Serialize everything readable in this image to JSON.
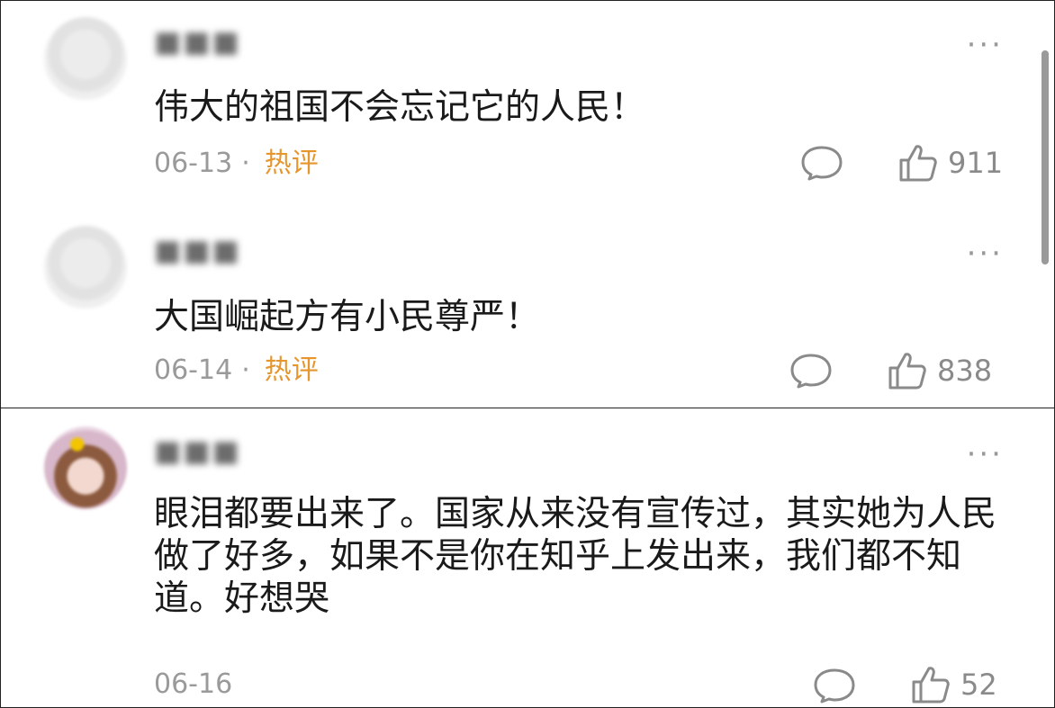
{
  "comments": [
    {
      "username": "",
      "text": "伟大的祖国不会忘记它的人民！",
      "date": "06-13",
      "separator": "·",
      "tag": "热评",
      "likes": "911"
    },
    {
      "username": "",
      "text": "大国崛起方有小民尊严！",
      "date": "06-14",
      "separator": "·",
      "tag": "热评",
      "likes": "838"
    },
    {
      "username": "",
      "text": "眼泪都要出来了。国家从来没有宣传过，其实她为人民做了好多，如果不是你在知乎上发出来，我们都不知道。好想哭",
      "date": "06-16",
      "likes": "52"
    }
  ],
  "icons": {
    "more": "more-dots-icon",
    "reply": "comment-bubble-icon",
    "like": "thumbs-up-icon"
  },
  "colors": {
    "hot_tag": "#e6962d",
    "meta_text": "#9a9a9a",
    "body_text": "#1a1a1a"
  }
}
